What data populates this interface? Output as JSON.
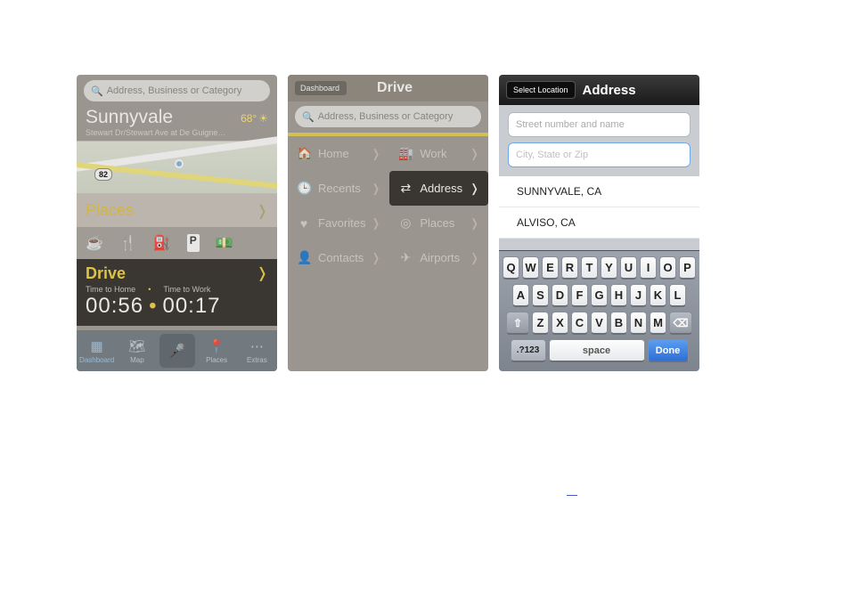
{
  "screen1": {
    "search_placeholder": "Address, Business or Category",
    "location_city": "Sunnyvale",
    "location_sub": "Stewart Dr/Stewart Ave at De Guigne…",
    "temperature": "68°",
    "route_shield": "82",
    "places_label": "Places",
    "place_icons": [
      "coffee-icon",
      "restaurant-icon",
      "gas-icon",
      "parking-icon",
      "atm-icon"
    ],
    "drive_label": "Drive",
    "time_home_label": "Time to Home",
    "time_work_label": "Time to Work",
    "time_home": "00:56",
    "time_work": "00:17",
    "tabs": [
      {
        "label": "Dashboard"
      },
      {
        "label": "Map"
      },
      {
        "label": ""
      },
      {
        "label": "Places"
      },
      {
        "label": "Extras"
      }
    ]
  },
  "screen2": {
    "back_label": "Dashboard",
    "title": "Drive",
    "search_placeholder": "Address, Business or Category",
    "items": [
      {
        "label": "Home"
      },
      {
        "label": "Work"
      },
      {
        "label": "Recents"
      },
      {
        "label": "Address"
      },
      {
        "label": "Favorites"
      },
      {
        "label": "Places"
      },
      {
        "label": "Contacts"
      },
      {
        "label": "Airports"
      }
    ]
  },
  "screen3": {
    "back_label": "Select Location",
    "title": "Address",
    "field1_placeholder": "Street number and name",
    "field2_placeholder": "City, State or Zip",
    "suggestions": [
      "SUNNYVALE, CA",
      "ALVISO, CA"
    ],
    "keyboard": {
      "row1": [
        "Q",
        "W",
        "E",
        "R",
        "T",
        "Y",
        "U",
        "I",
        "O",
        "P"
      ],
      "row2": [
        "A",
        "S",
        "D",
        "F",
        "G",
        "H",
        "J",
        "K",
        "L"
      ],
      "row3": [
        "Z",
        "X",
        "C",
        "V",
        "B",
        "N",
        "M"
      ],
      "num_label": ".?123",
      "space_label": "space",
      "done_label": "Done"
    }
  }
}
